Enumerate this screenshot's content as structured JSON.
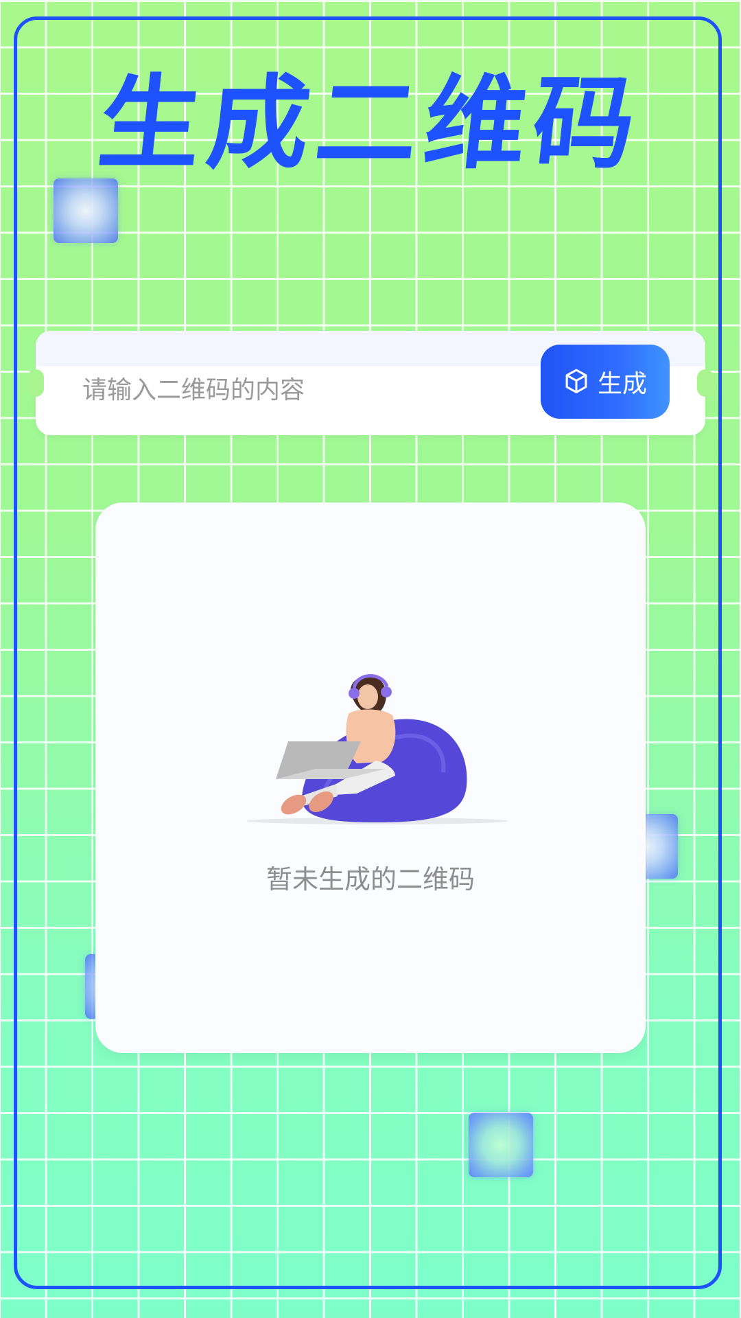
{
  "page": {
    "title": "生成二维码"
  },
  "input": {
    "placeholder": "请输入二维码的内容",
    "value": ""
  },
  "generate_button": {
    "label": "生成",
    "icon": "cube-icon"
  },
  "result": {
    "empty_text": "暂未生成的二维码",
    "illustration": "person-with-laptop-on-beanbag"
  },
  "colors": {
    "accent": "#1f52ff",
    "background_top": "#a9f88d",
    "background_bottom": "#7dfec9",
    "button_gradient_start": "#2054f5",
    "button_gradient_end": "#3f93ff",
    "placeholder_text": "#9a9a9a"
  }
}
